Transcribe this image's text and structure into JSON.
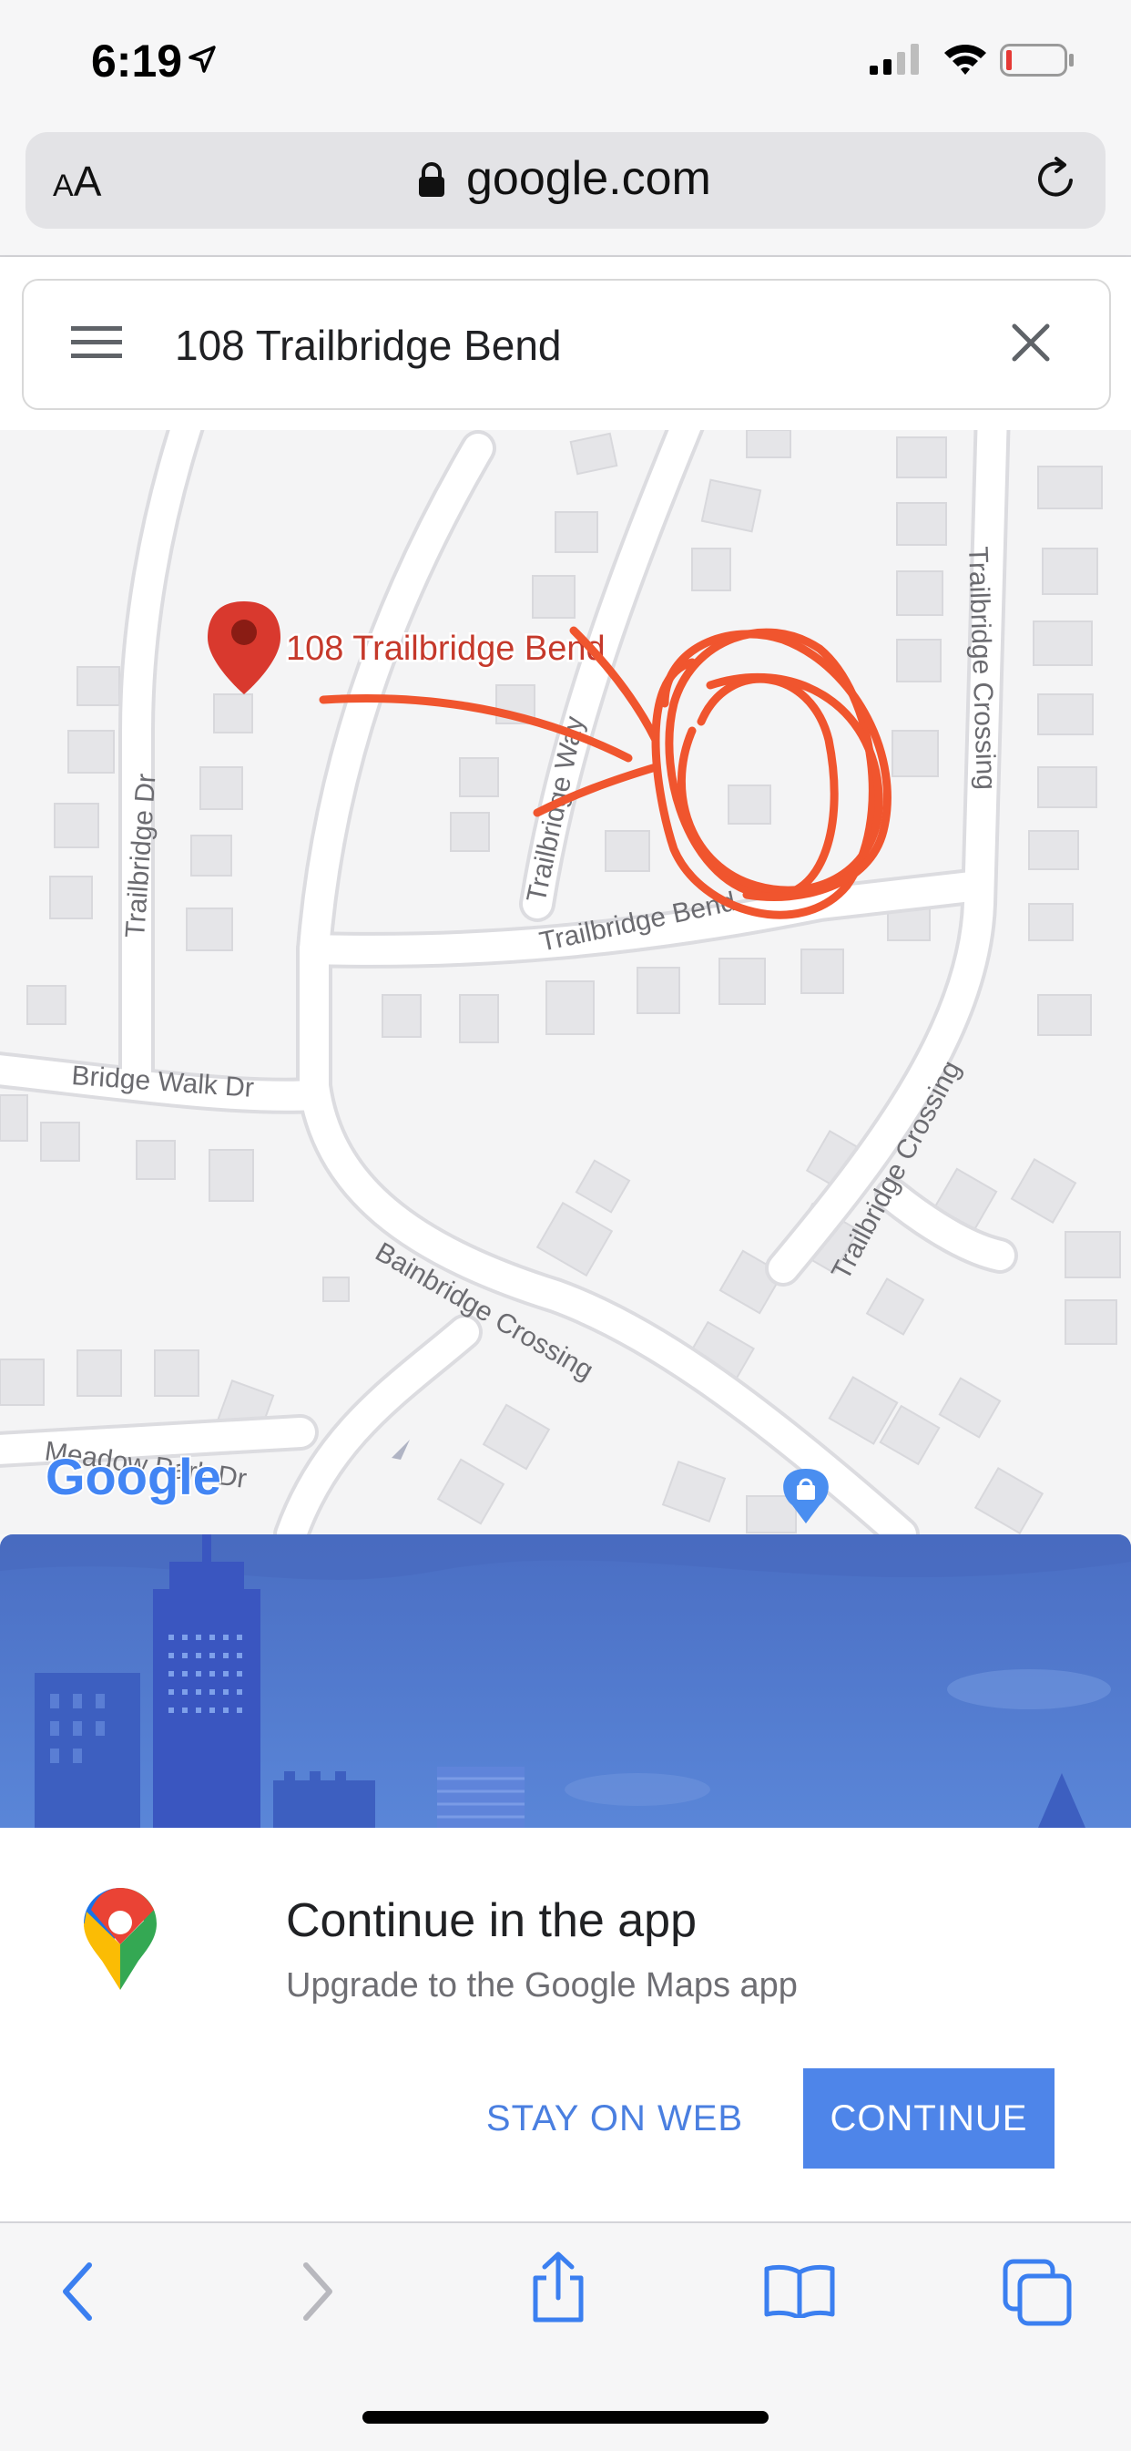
{
  "status_bar": {
    "time": "6:19",
    "icons": [
      "location-arrow-icon",
      "cell-signal-icon",
      "wifi-icon",
      "battery-low-icon"
    ]
  },
  "browser": {
    "text_size_label_small": "A",
    "text_size_label_large": "A",
    "domain": "google.com",
    "icons": [
      "lock-icon",
      "reload-icon"
    ]
  },
  "search": {
    "query": "108 Trailbridge Bend",
    "icons": [
      "hamburger-menu-icon",
      "close-icon"
    ]
  },
  "map": {
    "pin_label": "108 Trailbridge Bend",
    "streets": {
      "trailbridge_dr": "Trailbridge Dr",
      "trailbridge_way": "Trailbridge Way",
      "trailbridge_bend": "Trailbridge Bend",
      "trailbridge_crossing_top": "Trailbridge Crossing",
      "trailbridge_crossing_right": "Trailbridge Crossing",
      "bridge_walk_dr": "Bridge Walk Dr",
      "bainbridge_crossing": "Bainbridge Crossing",
      "meadow_park_dr": "Meadow Park Dr"
    },
    "logo": "Google",
    "colors": {
      "pin": "#d9392e",
      "pin_label": "#c5392b",
      "annotation": "#f0552e",
      "road": "#ffffff",
      "building": "#e6e6e8"
    }
  },
  "app_prompt": {
    "title": "Continue in the app",
    "subtitle": "Upgrade to the Google Maps app",
    "stay_label": "STAY ON WEB",
    "continue_label": "CONTINUE",
    "colors": {
      "accent": "#4e85e9",
      "banner": "#5a80d4"
    }
  },
  "toolbar": {
    "icons": [
      "back-icon",
      "forward-icon",
      "share-icon",
      "bookmarks-icon",
      "tabs-icon"
    ]
  }
}
